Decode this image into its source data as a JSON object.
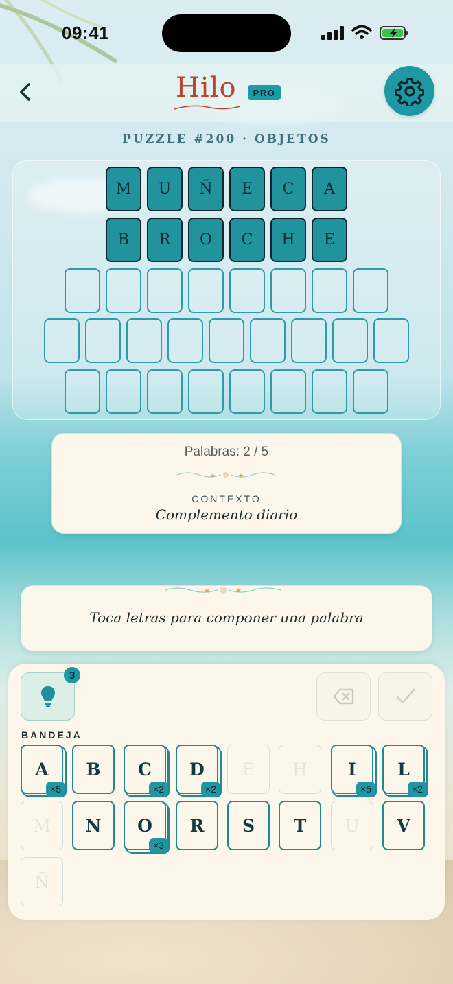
{
  "status_bar": {
    "time": "09:41"
  },
  "header": {
    "logo": "Hilo",
    "badge": "PRO"
  },
  "puzzle": {
    "title": "PUZZLE #200 · OBJETOS"
  },
  "board": {
    "found_words": [
      [
        "M",
        "U",
        "Ñ",
        "E",
        "C",
        "A"
      ],
      [
        "B",
        "R",
        "O",
        "C",
        "H",
        "E"
      ]
    ],
    "empty_rows": [
      8,
      9,
      8
    ]
  },
  "info": {
    "progress": "Palabras: 2 / 5",
    "context_label": "CONTEXTO",
    "context_value": "Complemento diario"
  },
  "instruction": "Toca letras para componer una palabra",
  "tray": {
    "hint_count": "3",
    "label": "BANDEJA",
    "keys": [
      {
        "letter": "A",
        "count": "×5",
        "state": "available"
      },
      {
        "letter": "B",
        "count": "",
        "state": "available"
      },
      {
        "letter": "C",
        "count": "×2",
        "state": "available"
      },
      {
        "letter": "D",
        "count": "×2",
        "state": "available"
      },
      {
        "letter": "E",
        "count": "",
        "state": "used"
      },
      {
        "letter": "H",
        "count": "",
        "state": "used"
      },
      {
        "letter": "I",
        "count": "×5",
        "state": "available"
      },
      {
        "letter": "L",
        "count": "×2",
        "state": "available"
      },
      {
        "letter": "M",
        "count": "",
        "state": "used"
      },
      {
        "letter": "N",
        "count": "",
        "state": "available"
      },
      {
        "letter": "O",
        "count": "×3",
        "state": "available"
      },
      {
        "letter": "R",
        "count": "",
        "state": "available"
      },
      {
        "letter": "S",
        "count": "",
        "state": "available"
      },
      {
        "letter": "T",
        "count": "",
        "state": "available"
      },
      {
        "letter": "U",
        "count": "",
        "state": "used"
      },
      {
        "letter": "V",
        "count": "",
        "state": "available"
      },
      {
        "letter": "Ñ",
        "count": "",
        "state": "used"
      }
    ]
  },
  "icons": {
    "back": "chevron-left-icon",
    "settings": "gear-icon",
    "hint": "lightbulb-icon",
    "delete": "backspace-icon",
    "submit": "checkmark-icon"
  },
  "colors": {
    "accent": "#1f98a6",
    "brand": "#b5472b",
    "card": "#fcf7ea"
  }
}
